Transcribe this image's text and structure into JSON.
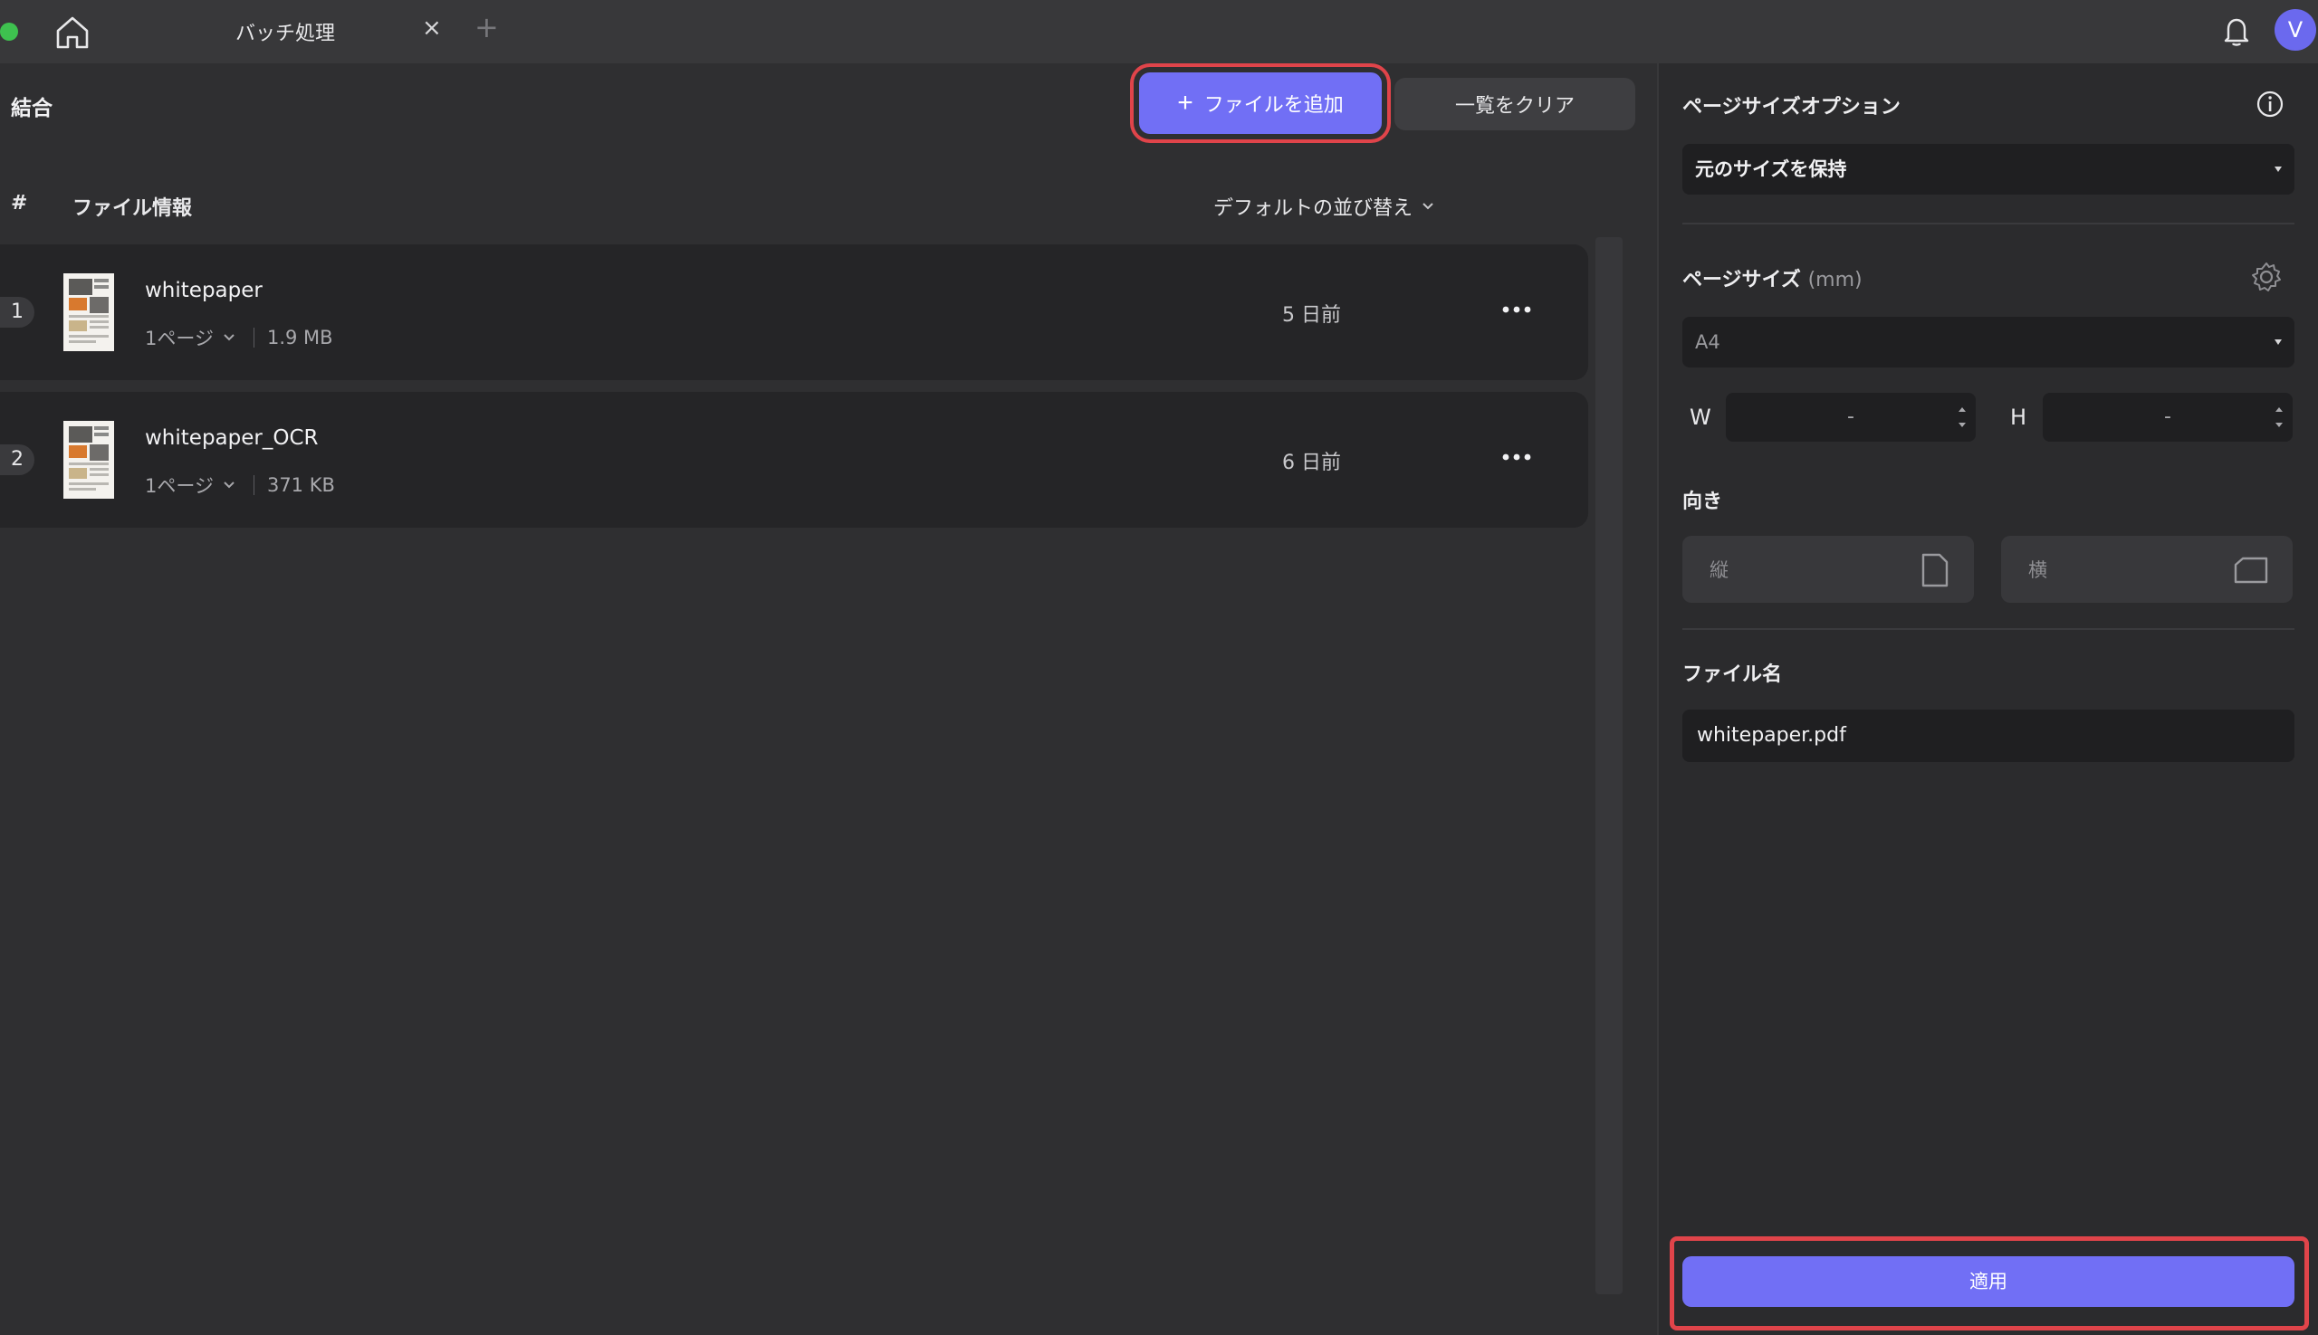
{
  "titlebar": {
    "tab_label": "バッチ処理",
    "tab_close": "×",
    "tab_add": "+",
    "avatar_initial": "V"
  },
  "main": {
    "section_title": "結合",
    "add_files_label": "ファイルを追加",
    "add_icon": "+",
    "clear_list_label": "一覧をクリア",
    "columns": {
      "index": "#",
      "file_info": "ファイル情報"
    },
    "sort_label": "デフォルトの並び替え",
    "files": [
      {
        "index": "1",
        "name": "whitepaper",
        "pages": "1ページ",
        "size": "1.9 MB",
        "date": "5 日前"
      },
      {
        "index": "2",
        "name": "whitepaper_OCR",
        "pages": "1ページ",
        "size": "371 KB",
        "date": "6 日前"
      }
    ]
  },
  "sidebar": {
    "page_size_options_title": "ページサイズオプション",
    "page_size_option_value": "元のサイズを保持",
    "page_size_title": "ページサイズ",
    "page_size_unit": "(mm)",
    "paper_value": "A4",
    "width_label": "W",
    "height_label": "H",
    "width_value": "-",
    "height_value": "-",
    "orientation_title": "向き",
    "portrait_label": "縦",
    "landscape_label": "横",
    "filename_title": "ファイル名",
    "filename_value": "whitepaper.pdf",
    "apply_label": "適用"
  },
  "colors": {
    "accent": "#716ff5",
    "highlight_border": "#e0444a",
    "window_dot": "#3ec14f",
    "background": "#2f2f31"
  },
  "icons": [
    "home-icon",
    "close-icon",
    "plus-icon",
    "bell-icon",
    "chevron-down-icon",
    "more-icon",
    "info-icon",
    "gear-icon",
    "portrait-page-icon",
    "landscape-page-icon"
  ]
}
